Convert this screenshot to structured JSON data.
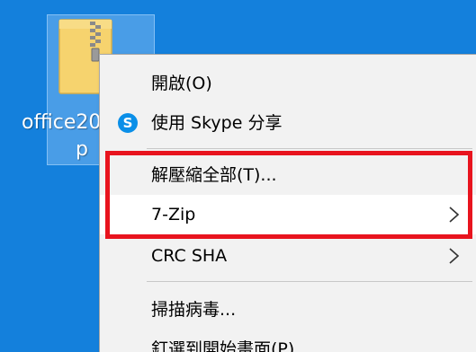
{
  "desktop": {
    "file_icon": {
      "label_line1": "office20",
      "label_line2": "p"
    }
  },
  "context_menu": {
    "items": [
      {
        "label": "開啟(O)"
      },
      {
        "label": "使用 Skype 分享"
      },
      {
        "label": "解壓縮全部(T)..."
      },
      {
        "label": "7-Zip"
      },
      {
        "label": "CRC SHA"
      },
      {
        "label": "掃描病毒..."
      },
      {
        "label": "釘選到開始畫面(P)"
      }
    ]
  },
  "colors": {
    "desktop_bg": "#1480dc",
    "highlight_border": "#e8141e",
    "skype_blue": "#0a8fe8"
  }
}
